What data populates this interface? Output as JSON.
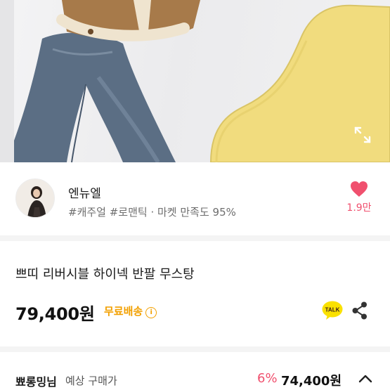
{
  "seller": {
    "name": "엔뉴엘",
    "tags": "#캐주얼 #로맨틱 · 마켓 만족도 95%",
    "like_count": "1.9만"
  },
  "product": {
    "title": "쁘띠 리버시블 하이넥 반팔 무스탕",
    "price": "79,400원",
    "shipping_label": "무료배송",
    "info_glyph": "i"
  },
  "expected_price": {
    "user": "뾰롱밍님",
    "label": "예상 구매가",
    "discount_rate": "6%",
    "price": "74,400원"
  },
  "icons": {
    "expand": "expand-icon",
    "heart": "heart-icon",
    "info": "info-icon",
    "talk": "kakaotalk-icon",
    "share": "share-icon",
    "chevron": "chevron-up-icon"
  },
  "talk_badge": "TALK",
  "colors": {
    "accent_pink": "#f0506e",
    "shipping_orange": "#f2a000",
    "talk_yellow": "#fae100",
    "cabinet_yellow": "#f1dc7e"
  }
}
